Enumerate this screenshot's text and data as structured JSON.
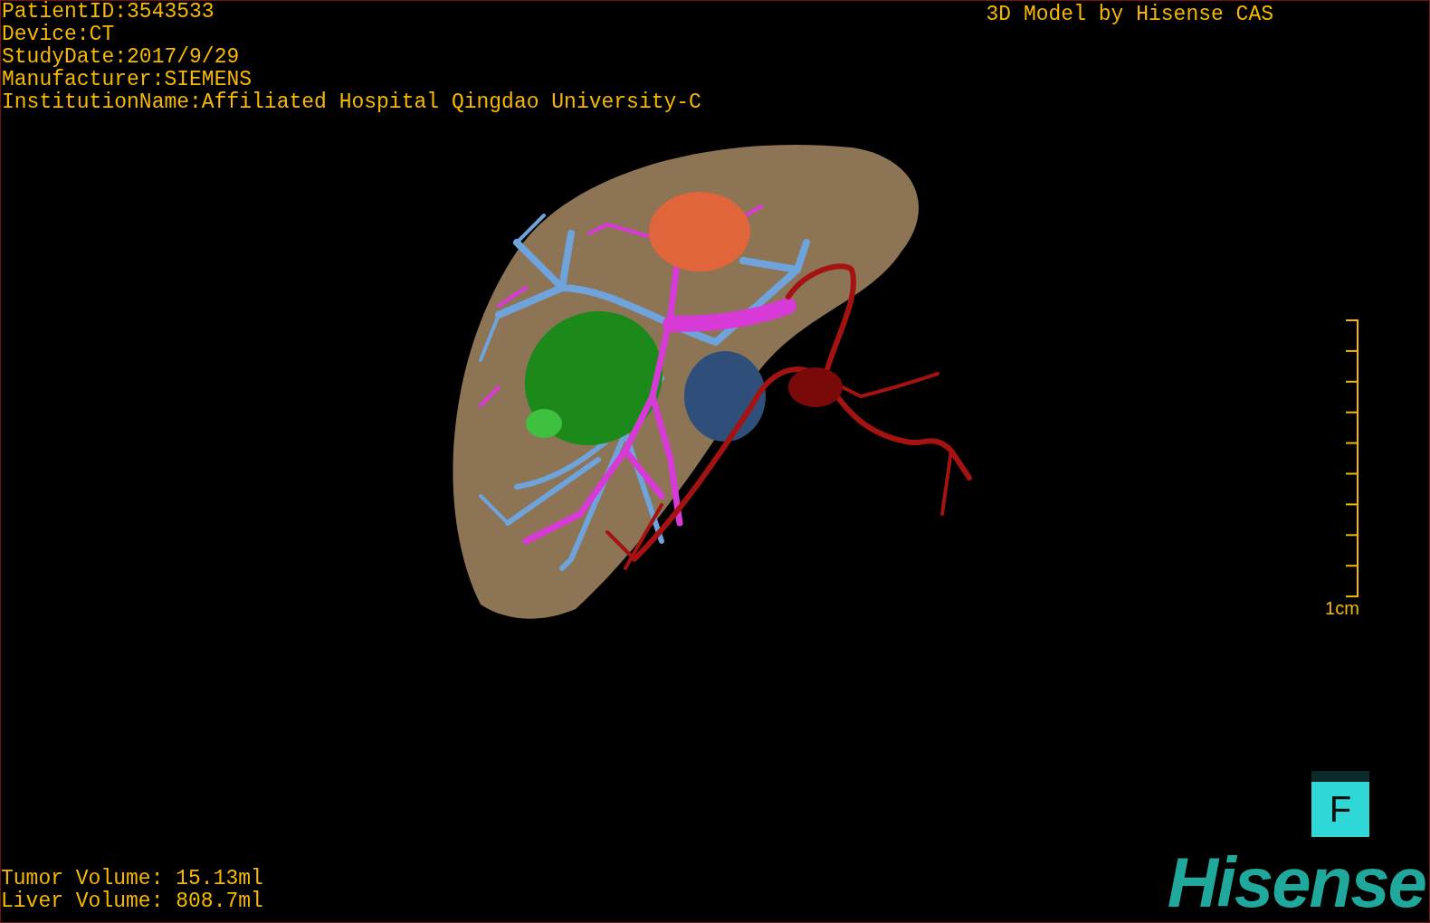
{
  "info": [
    "PatientID:3543533",
    "Device:CT",
    "StudyDate:2017/9/29",
    "Manufacturer:SIEMENS",
    "InstitutionName:Affiliated Hospital Qingdao University-C"
  ],
  "title": "3D Model by Hisense CAS",
  "scale_bar": {
    "label": "1cm"
  },
  "volumes": [
    "Tumor Volume: 15.13ml",
    "Liver Volume: 808.7ml"
  ],
  "orientation_button": {
    "label": "F"
  },
  "logo": "Hisense"
}
